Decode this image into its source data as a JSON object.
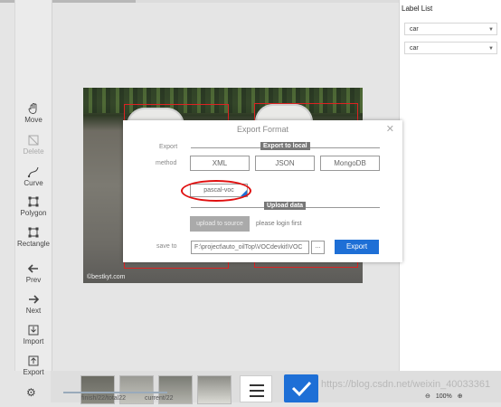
{
  "toolbar": {
    "move": "Move",
    "delete": "Delete",
    "curve": "Curve",
    "polygon": "Polygon",
    "rectangle": "Rectangle",
    "prev": "Prev",
    "next": "Next",
    "import": "Import",
    "export": "Export"
  },
  "right_panel": {
    "title": "Label List",
    "labels": [
      "car",
      "car"
    ]
  },
  "modal": {
    "title": "Export Format",
    "close": "✕",
    "export_label": "Export",
    "export_to_local": "Export to local",
    "method_label": "method",
    "formats": [
      "XML",
      "JSON",
      "MongoDB"
    ],
    "selected_format": "pascal-voc",
    "upload_data": "Upload data",
    "upload_to_source": "upload to source",
    "login_note": "please login first",
    "save_to_label": "save to",
    "save_path": "F:\\project\\auto_oilTop\\VOCdevkit\\VOC",
    "browse": "...",
    "export_button": "Export"
  },
  "bottom": {
    "status1": "finish/22/total22",
    "status2": "current/22",
    "watermark": "https://blog.csdn.net/weixin_40033361",
    "zoom": "100%",
    "zoom_minus": "⊖",
    "zoom_plus": "⊕"
  },
  "canvas": {
    "image_watermark": "©bestkyt.com"
  },
  "colors": {
    "accent": "#1e6fd6",
    "annotation": "#e01010"
  }
}
